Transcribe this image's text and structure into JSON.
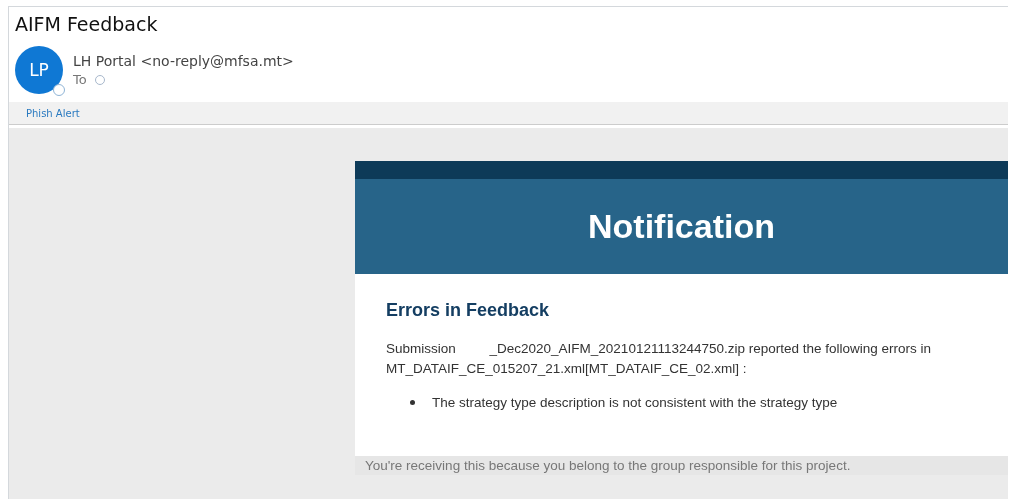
{
  "email": {
    "subject": "AIFM Feedback",
    "avatar_initials": "LP",
    "sender": "LH Portal <no-reply@mfsa.mt>",
    "to_label": "To"
  },
  "addin_bar": {
    "link": "Phish Alert"
  },
  "message": {
    "banner_title": "Notification",
    "heading": "Errors in Feedback",
    "paragraph": "Submission         _Dec2020_AIFM_20210121113244750.zip reported the following errors in MT_DATAIF_CE_015207_21.xml[MT_DATAIF_CE_02.xml] :",
    "errors": [
      "The strategy type description is not consistent with the strategy type"
    ],
    "footer": "You're receiving this because you belong to the group responsible for this project."
  }
}
